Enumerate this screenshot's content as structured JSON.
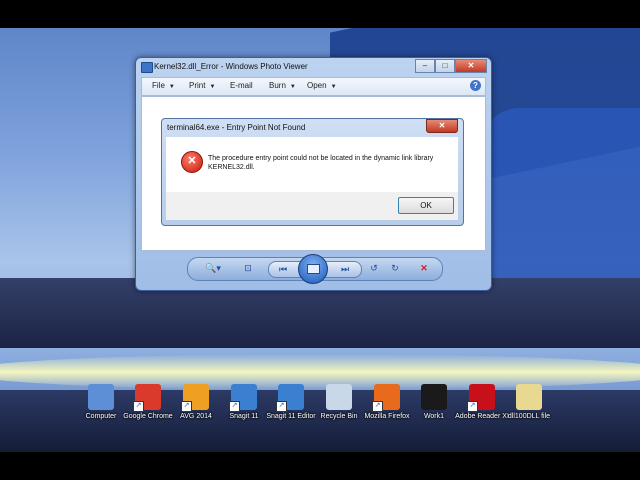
{
  "photo_viewer": {
    "title": "Kernel32.dll_Error - Windows Photo Viewer",
    "menu": [
      {
        "label": "File",
        "caret": "▼"
      },
      {
        "label": "Print",
        "caret": "▼"
      },
      {
        "label": "E-mail",
        "caret": ""
      },
      {
        "label": "Burn",
        "caret": "▼"
      },
      {
        "label": "Open",
        "caret": "▼"
      }
    ],
    "help_glyph": "?",
    "window_buttons": {
      "minimize": "–",
      "maximize": "□",
      "close": "✕"
    },
    "nav_glyphs": {
      "zoom": "🔍▾",
      "actual_size": "⊡",
      "previous": "⏮",
      "next": "⏭",
      "rotate_ccw": "↺",
      "rotate_cw": "↻",
      "delete": "✕"
    }
  },
  "dialog": {
    "title": "terminal64.exe - Entry Point Not Found",
    "close_glyph": "✕",
    "error_glyph": "✕",
    "message": "The procedure entry point  could not be located in the dynamic link library KERNEL32.dll.",
    "ok_label": "OK"
  },
  "desktop_icons": [
    {
      "label": "Computer",
      "icon": "computer-icon",
      "color": "#5d8fd6",
      "shortcut": false
    },
    {
      "label": "Google Chrome",
      "icon": "chrome-icon",
      "color": "#d93a2b",
      "shortcut": true
    },
    {
      "label": "AVG 2014",
      "icon": "avg-icon",
      "color": "#f0a020",
      "shortcut": true
    },
    {
      "label": "Snagit 11",
      "icon": "snagit-icon",
      "color": "#3a7fd0",
      "shortcut": true
    },
    {
      "label": "Snagit 11 Editor",
      "icon": "snagit-editor-icon",
      "color": "#3a7fd0",
      "shortcut": true
    },
    {
      "label": "Recycle Bin",
      "icon": "recycle-bin-icon",
      "color": "#c8d8e8",
      "shortcut": false
    },
    {
      "label": "Mozilla Firefox",
      "icon": "firefox-icon",
      "color": "#e86a1c",
      "shortcut": true
    },
    {
      "label": "Work1",
      "icon": "media-file-icon",
      "color": "#1a1a1a",
      "shortcut": false
    },
    {
      "label": "Adobe Reader XI",
      "icon": "adobe-reader-icon",
      "color": "#c8101a",
      "shortcut": true
    },
    {
      "label": "dll100DLL file",
      "icon": "text-file-icon",
      "color": "#e8d890",
      "shortcut": false
    }
  ],
  "shortcut_glyph": "↗"
}
